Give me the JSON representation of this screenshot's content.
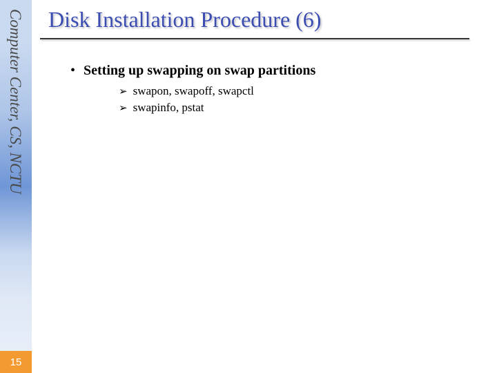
{
  "sidebar": {
    "label": "Computer Center, CS, NCTU"
  },
  "page_number": "15",
  "title": "Disk Installation Procedure (6)",
  "bullets": [
    {
      "text": "Setting up swapping on swap partitions",
      "subs": [
        "swapon, swapoff, swapctl",
        "swapinfo, pstat"
      ]
    }
  ]
}
